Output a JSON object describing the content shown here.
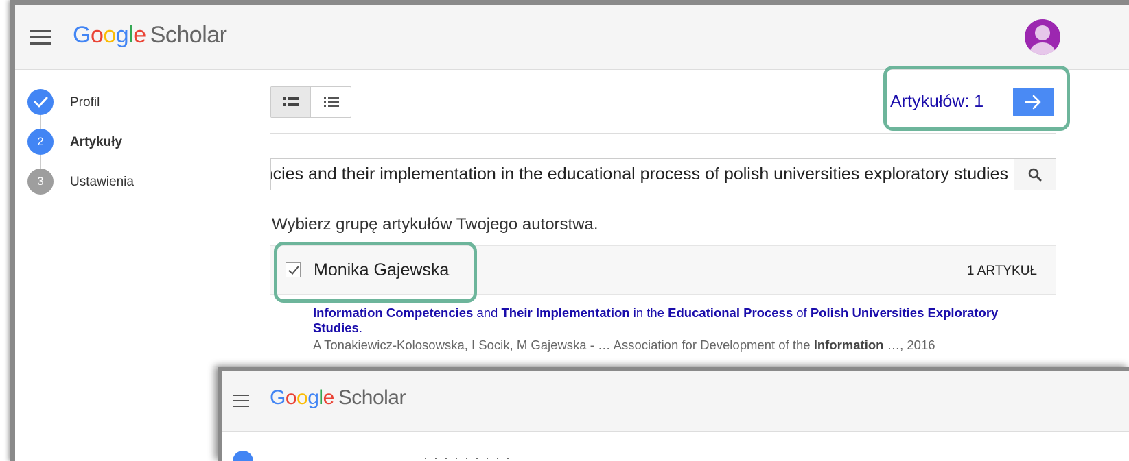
{
  "app": {
    "logo_letters": [
      "G",
      "o",
      "o",
      "g",
      "l",
      "e"
    ],
    "logo_product": "Scholar"
  },
  "colors": {
    "google_blue": "#4285f4",
    "google_red": "#ea4335",
    "google_yellow": "#fbbc05",
    "google_green": "#34a853",
    "link_blue": "#1a0dab",
    "next_button": "#4a8af4",
    "highlight_border": "#6db59b",
    "avatar": "#9c27b0"
  },
  "steps": [
    {
      "number": "",
      "label": "Profil",
      "state": "done",
      "icon": "check-icon"
    },
    {
      "number": "2",
      "label": "Artykuły",
      "state": "active"
    },
    {
      "number": "3",
      "label": "Ustawienia",
      "state": "pending"
    }
  ],
  "toolbar": {
    "articles_count": "Artykułów: 1",
    "next_icon": "arrow-right-icon",
    "view_icons": [
      "detailed-list-icon",
      "list-icon"
    ]
  },
  "search": {
    "value": "Information Competencies and their implementation in the educational process of polish universities exploratory studies",
    "icon": "search-icon"
  },
  "instruction": "Wybierz grupę artykułów Twojego autorstwa.",
  "group": {
    "author": "Monika Gajewska",
    "count": "1 ARTYKUŁ",
    "checked": true
  },
  "article": {
    "title_parts": [
      {
        "text": "Information Competencies",
        "bold": true
      },
      {
        "text": " and ",
        "bold": false
      },
      {
        "text": "Their Implementation",
        "bold": true
      },
      {
        "text": " in the ",
        "bold": false
      },
      {
        "text": "Educational Process",
        "bold": true
      },
      {
        "text": " of ",
        "bold": false
      },
      {
        "text": "Polish Universities Exploratory Studies",
        "bold": true
      },
      {
        "text": ".",
        "bold": false
      }
    ],
    "meta_before": "A Tonakiewicz-Kolosowska, I Socik, M Gajewska - … Association for Development of the ",
    "meta_bold": "Information",
    "meta_after": " …, 2016"
  },
  "overlay": {
    "logo_product": "Scholar",
    "partial_text": "· · · · · · · · ·"
  }
}
